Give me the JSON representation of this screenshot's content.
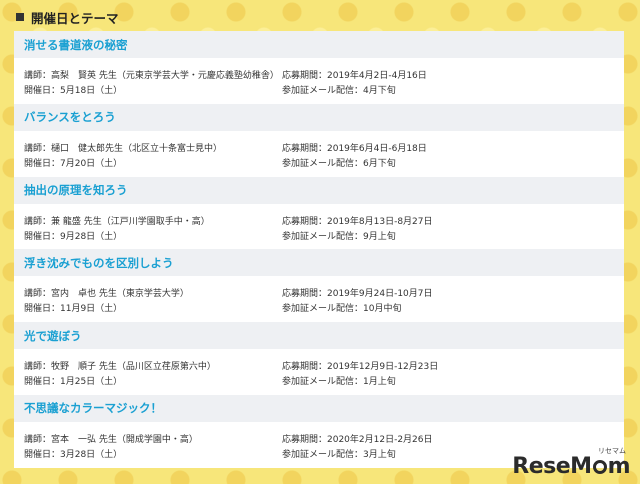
{
  "heading": {
    "title": "開催日とテーマ"
  },
  "events": [
    {
      "title": "消せる書道液の秘密",
      "lecturer": "講師：高梨　賢英 先生（元東京学芸大学・元慶応義塾幼稚舎）",
      "date": "開催日：5月18日（土）",
      "period": "応募期間：2019年4月2日-4月16日",
      "mail": "参加証メール配信：4月下旬"
    },
    {
      "title": "バランスをとろう",
      "lecturer": "講師：樋口　健太郎先生（北区立十条富士見中）",
      "date": "開催日：7月20日（土）",
      "period": "応募期間：2019年6月4日-6月18日",
      "mail": "参加証メール配信：6月下旬"
    },
    {
      "title": "抽出の原理を知ろう",
      "lecturer": "講師：兼 龍盛 先生（江戸川学園取手中・高）",
      "date": "開催日：9月28日（土）",
      "period": "応募期間：2019年8月13日-8月27日",
      "mail": "参加証メール配信：9月上旬"
    },
    {
      "title": "浮き沈みでものを区別しよう",
      "lecturer": "講師：宮内　卓也 先生（東京学芸大学）",
      "date": "開催日：11月9日（土）",
      "period": "応募期間：2019年9月24日-10月7日",
      "mail": "参加証メール配信：10月中旬"
    },
    {
      "title": "光で遊ぼう",
      "lecturer": "講師：牧野　順子 先生（品川区立荏原第六中）",
      "date": "開催日：1月25日（土）",
      "period": "応募期間：2019年12月9日-12月23日",
      "mail": "参加証メール配信：1月上旬"
    },
    {
      "title": "不思議なカラーマジック！",
      "lecturer": "講師：宮本　一弘 先生（開成学園中・高）",
      "date": "開催日：3月28日（土）",
      "period": "応募期間：2020年2月12日-2月26日",
      "mail": "参加証メール配信：3月上旬"
    }
  ],
  "watermark": {
    "small": "リセマム",
    "logo_a": "ResеM",
    "logo_b": "m"
  },
  "colors": {
    "accent": "#1aa0d2",
    "background": "#f7e67a",
    "title_bar": "#eef0f3"
  }
}
